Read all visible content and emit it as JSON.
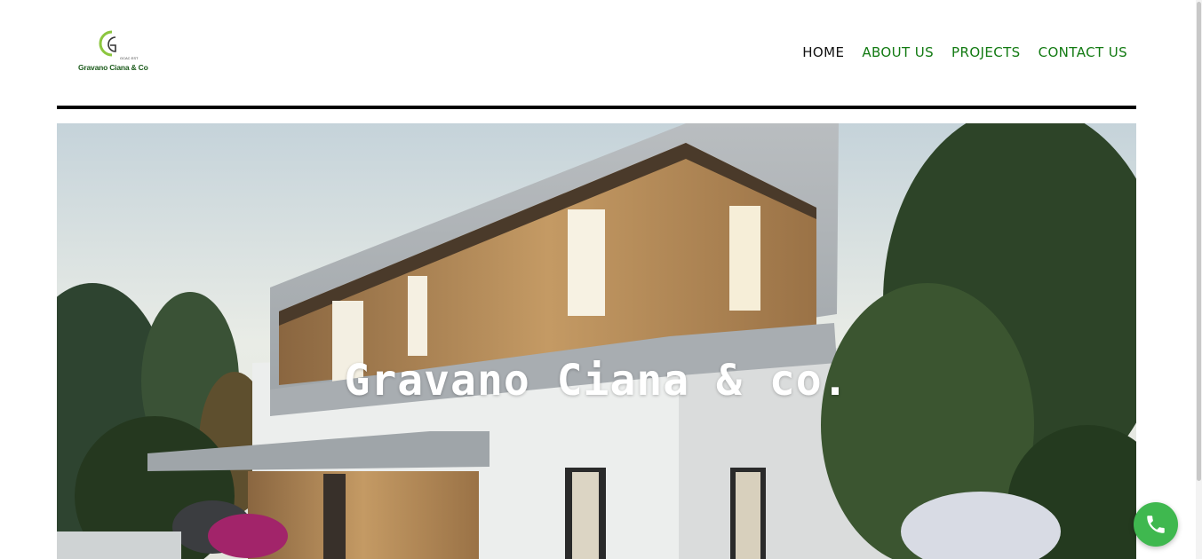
{
  "brand": {
    "name": "Gravano Ciana & Co",
    "tagline": "GCAC EST",
    "colors": {
      "accent": "#8cc63f",
      "text": "#1c5b1c"
    }
  },
  "nav": {
    "items": [
      {
        "label": "HOME",
        "active": true
      },
      {
        "label": "ABOUT US",
        "active": false
      },
      {
        "label": "PROJECTS",
        "active": false
      },
      {
        "label": "CONTACT US",
        "active": false
      }
    ],
    "colors": {
      "active": "#111111",
      "link": "#127a12"
    }
  },
  "hero": {
    "title": "Gravano Ciana & co.",
    "image": "modern-house-render"
  },
  "floating": {
    "phone_icon": "phone-icon",
    "color": "#3fb84f"
  }
}
